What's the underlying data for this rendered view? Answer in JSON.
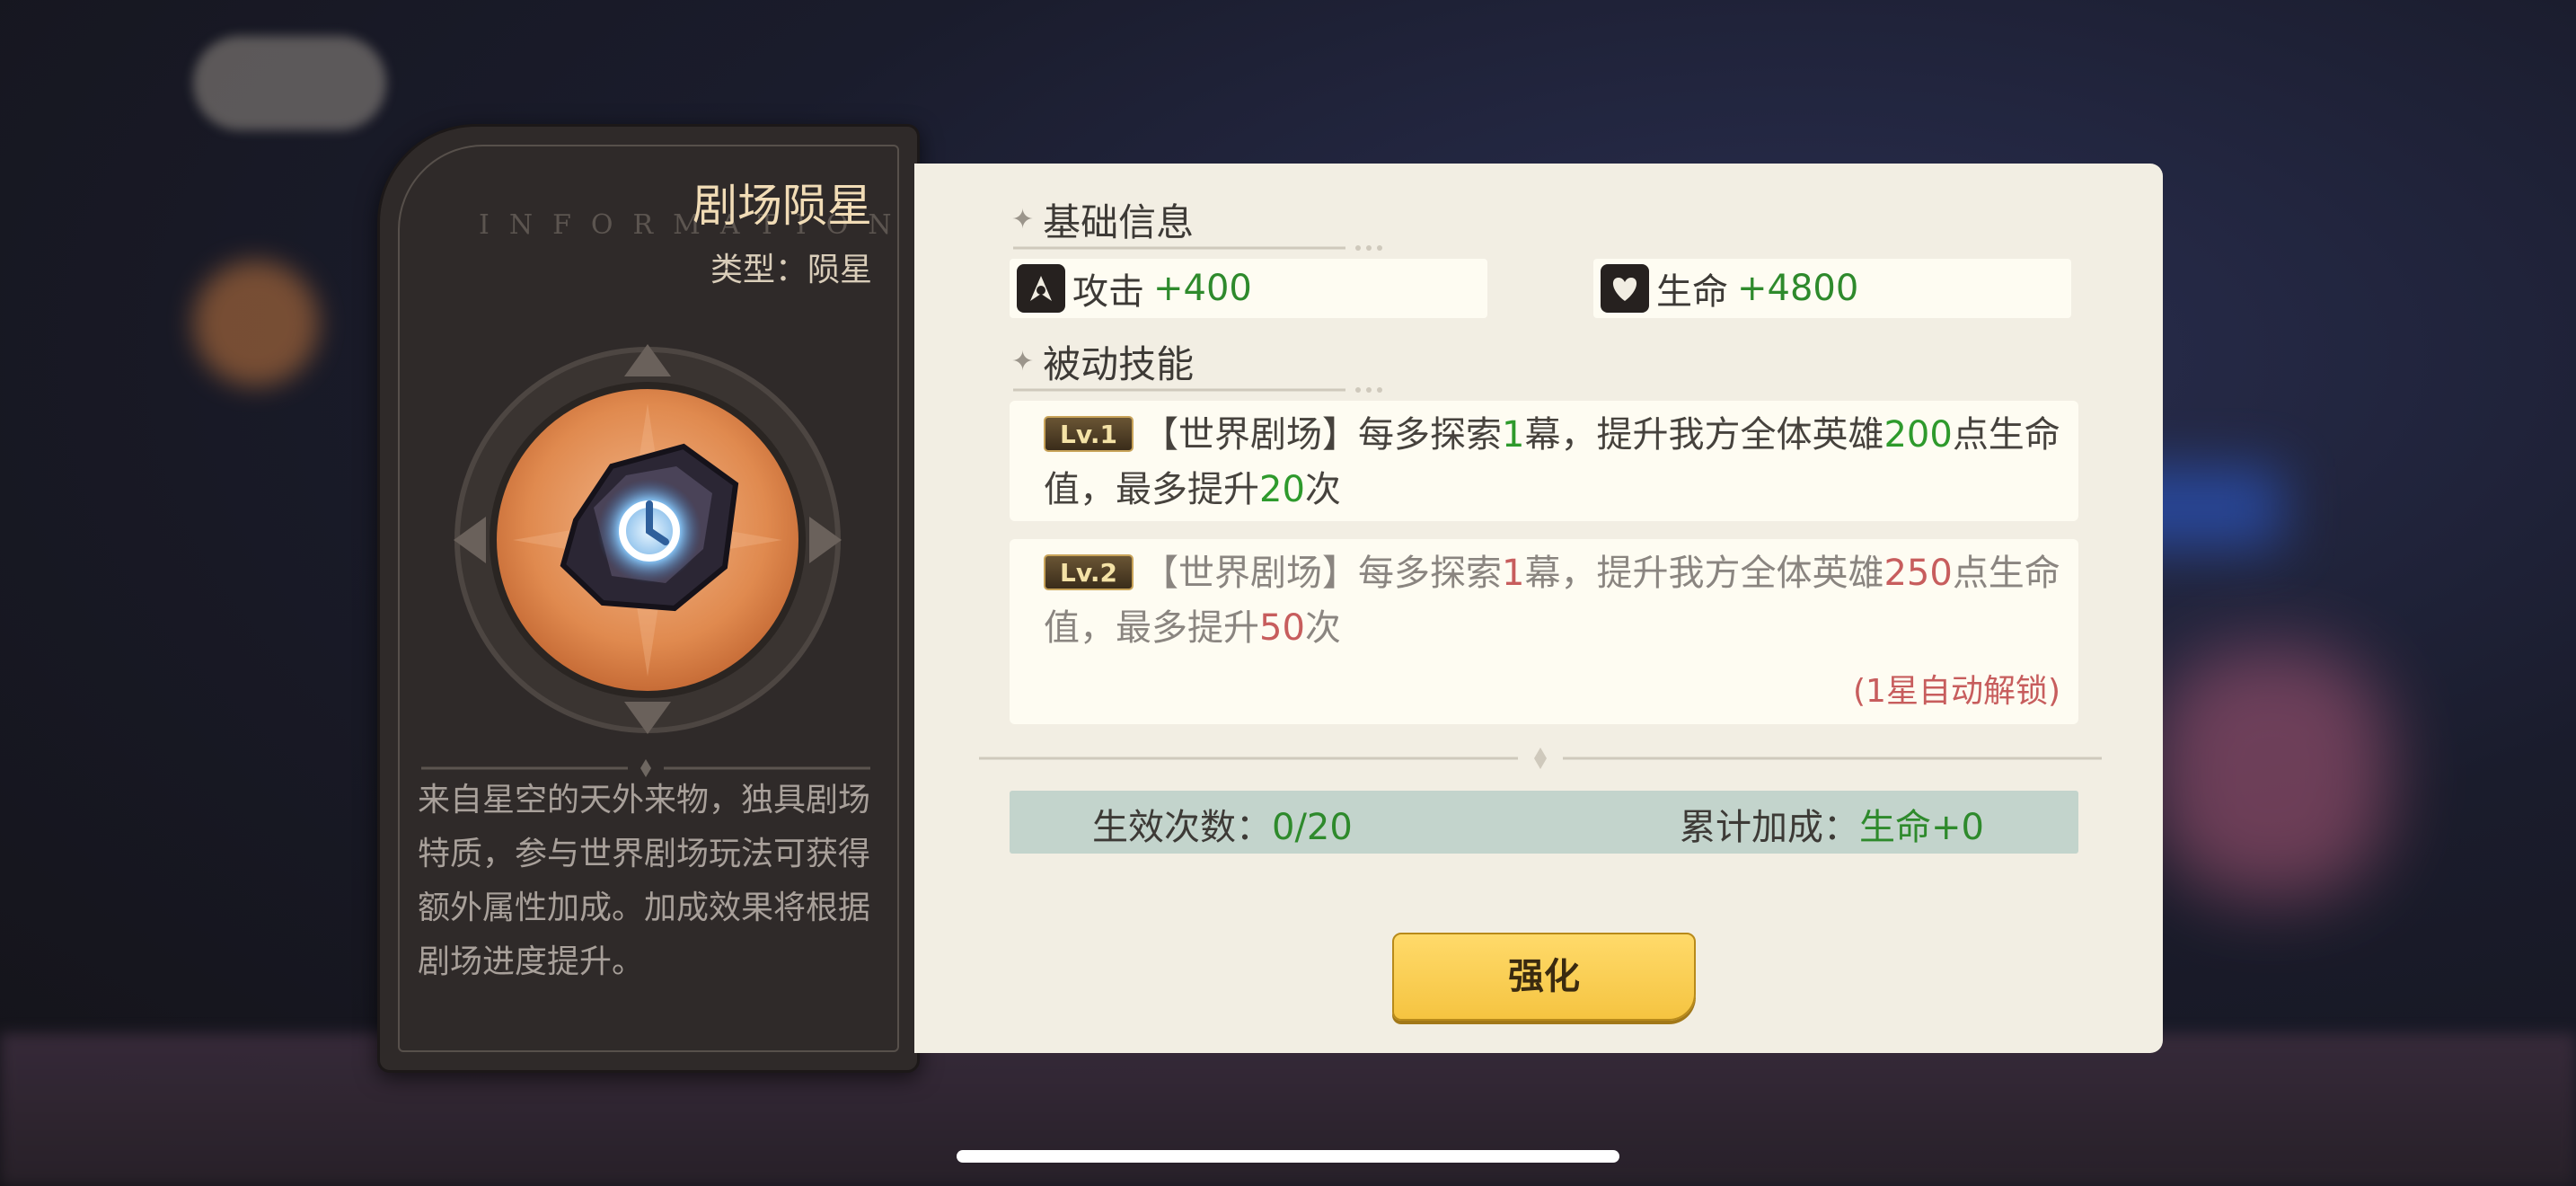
{
  "item": {
    "name": "剧场陨星",
    "watermark": "INFORMATION",
    "type_label": "类型：",
    "type_value": "陨星",
    "description": "来自星空的天外来物，独具剧场特质，参与世界剧场玩法可获得额外属性加成。加成效果将根据剧场进度提升。"
  },
  "basic_info": {
    "title": "基础信息",
    "stats": [
      {
        "icon": "attack-icon",
        "label": "攻击",
        "value": "+400"
      },
      {
        "icon": "heart-icon",
        "label": "生命",
        "value": "+4800"
      }
    ]
  },
  "passive": {
    "title": "被动技能",
    "skills": [
      {
        "level": "Lv.1",
        "locked": false,
        "segments": [
          "【世界剧场】每多探索",
          "1",
          "幕，提升我方全体英雄",
          "200",
          "点生命值，最多提升",
          "20",
          "次"
        ]
      },
      {
        "level": "Lv.2",
        "locked": true,
        "segments": [
          "【世界剧场】每多探索",
          "1",
          "幕，提升我方全体英雄",
          "250",
          "点生命值，最多提升",
          "50",
          "次"
        ],
        "unlock_note": "(1星自动解锁)"
      }
    ]
  },
  "summary": {
    "count_label": "生效次数：",
    "count_value": "0/20",
    "bonus_label": "累计加成：",
    "bonus_value": "生命+0"
  },
  "upgrade_button": "强化",
  "colors": {
    "gain_green": "#2e9a2c",
    "locked_red": "#c75d5d",
    "button_yellow": "#ffd04f",
    "panel_bg": "#f2eee3",
    "dark_panel": "#2f2a29"
  }
}
